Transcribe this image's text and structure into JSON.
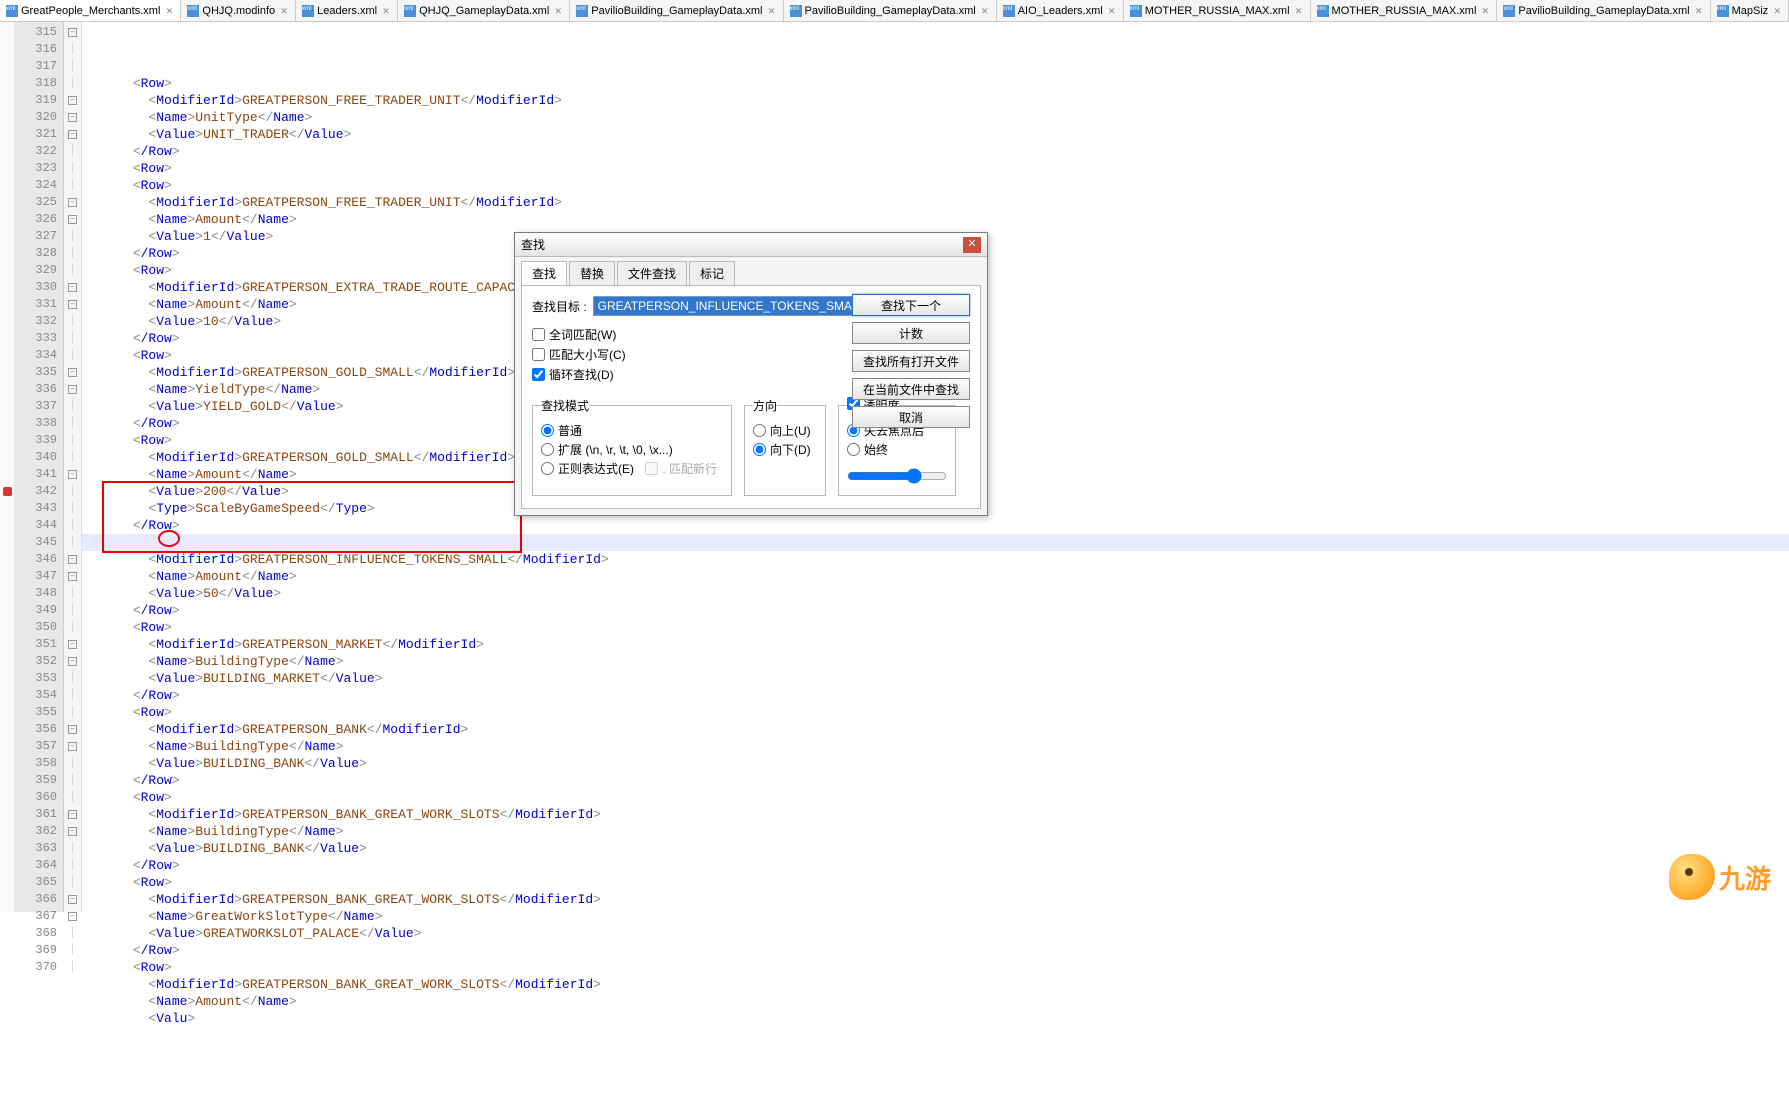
{
  "tabs": [
    {
      "label": "GreatPeople_Merchants.xml",
      "active": true
    },
    {
      "label": "QHJQ.modinfo",
      "active": false
    },
    {
      "label": "Leaders.xml",
      "active": false
    },
    {
      "label": "QHJQ_GameplayData.xml",
      "active": false
    },
    {
      "label": "PavilioBuilding_GameplayData.xml",
      "active": false
    },
    {
      "label": "PavilioBuilding_GameplayData.xml",
      "active": false
    },
    {
      "label": "AIO_Leaders.xml",
      "active": false
    },
    {
      "label": "MOTHER_RUSSIA_MAX.xml",
      "active": false
    },
    {
      "label": "MOTHER_RUSSIA_MAX.xml",
      "active": false
    },
    {
      "label": "PavilioBuilding_GameplayData.xml",
      "active": false
    },
    {
      "label": "MapSiz",
      "active": false
    }
  ],
  "line_start": 315,
  "highlight_line_index": 30,
  "code_lines": [
    {
      "i": 0,
      "t": "      <Row>"
    },
    {
      "i": 1,
      "t": "        <ModifierId>",
      "v": "GREATPERSON_FREE_TRADER_UNIT",
      "c": "</ModifierId>"
    },
    {
      "i": 1,
      "t": "        <Name>",
      "v": "UnitType",
      "c": "</Name>"
    },
    {
      "i": 1,
      "t": "        <Value>",
      "v": "UNIT_TRADER",
      "c": "</Value>"
    },
    {
      "i": 0,
      "t": "      </Row>"
    },
    {
      "i": 0,
      "t": "      <Row>"
    },
    {
      "i": 0,
      "t": "      <Row>"
    },
    {
      "i": 1,
      "t": "        <ModifierId>",
      "v": "GREATPERSON_FREE_TRADER_UNIT",
      "c": "</ModifierId>"
    },
    {
      "i": 1,
      "t": "        <Name>",
      "v": "Amount",
      "c": "</Name>"
    },
    {
      "i": 1,
      "t": "        <Value>",
      "v": "1",
      "c": "</Value>"
    },
    {
      "i": 0,
      "t": "      </Row>"
    },
    {
      "i": 0,
      "t": "      <Row>"
    },
    {
      "i": 1,
      "t": "        <ModifierId>",
      "v": "GREATPERSON_EXTRA_TRADE_ROUTE_CAPACITY",
      "c": "</ModifierId>"
    },
    {
      "i": 1,
      "t": "        <Name>",
      "v": "Amount",
      "c": "</Name>"
    },
    {
      "i": 1,
      "t": "        <Value>",
      "v": "10",
      "c": "</Value>"
    },
    {
      "i": 0,
      "t": "      </Row>"
    },
    {
      "i": 0,
      "t": "      <Row>"
    },
    {
      "i": 1,
      "t": "        <ModifierId>",
      "v": "GREATPERSON_GOLD_SMALL",
      "c": "</ModifierId>"
    },
    {
      "i": 1,
      "t": "        <Name>",
      "v": "YieldType",
      "c": "</Name>"
    },
    {
      "i": 1,
      "t": "        <Value>",
      "v": "YIELD_GOLD",
      "c": "</Value>"
    },
    {
      "i": 0,
      "t": "      </Row>"
    },
    {
      "i": 0,
      "t": "      <Row>"
    },
    {
      "i": 1,
      "t": "        <ModifierId>",
      "v": "GREATPERSON_GOLD_SMALL",
      "c": "</ModifierId>"
    },
    {
      "i": 1,
      "t": "        <Name>",
      "v": "Amount",
      "c": "</Name>"
    },
    {
      "i": 1,
      "t": "        <Value>",
      "v": "200",
      "c": "</Value>"
    },
    {
      "i": 1,
      "t": "        <Type>",
      "v": "ScaleByGameSpeed",
      "c": "</Type>"
    },
    {
      "i": 0,
      "t": "      </Row>"
    },
    {
      "i": 0,
      "t": "      "
    },
    {
      "i": 1,
      "t": "        <ModifierId>",
      "v": "GREATPERSON_INFLUENCE_TOKENS_SMALL",
      "c": "</ModifierId>"
    },
    {
      "i": 1,
      "t": "        <Name>",
      "v": "Amount",
      "c": "</Name>"
    },
    {
      "i": 1,
      "t": "        <Value>",
      "v": "50",
      "c": "</Value>"
    },
    {
      "i": 0,
      "t": "      </Row>"
    },
    {
      "i": 0,
      "t": "      <Row>"
    },
    {
      "i": 1,
      "t": "        <ModifierId>",
      "v": "GREATPERSON_MARKET",
      "c": "</ModifierId>"
    },
    {
      "i": 1,
      "t": "        <Name>",
      "v": "BuildingType",
      "c": "</Name>"
    },
    {
      "i": 1,
      "t": "        <Value>",
      "v": "BUILDING_MARKET",
      "c": "</Value>"
    },
    {
      "i": 0,
      "t": "      </Row>"
    },
    {
      "i": 0,
      "t": "      <Row>"
    },
    {
      "i": 1,
      "t": "        <ModifierId>",
      "v": "GREATPERSON_BANK",
      "c": "</ModifierId>"
    },
    {
      "i": 1,
      "t": "        <Name>",
      "v": "BuildingType",
      "c": "</Name>"
    },
    {
      "i": 1,
      "t": "        <Value>",
      "v": "BUILDING_BANK",
      "c": "</Value>"
    },
    {
      "i": 0,
      "t": "      </Row>"
    },
    {
      "i": 0,
      "t": "      <Row>"
    },
    {
      "i": 1,
      "t": "        <ModifierId>",
      "v": "GREATPERSON_BANK_GREAT_WORK_SLOTS",
      "c": "</ModifierId>"
    },
    {
      "i": 1,
      "t": "        <Name>",
      "v": "BuildingType",
      "c": "</Name>"
    },
    {
      "i": 1,
      "t": "        <Value>",
      "v": "BUILDING_BANK",
      "c": "</Value>"
    },
    {
      "i": 0,
      "t": "      </Row>"
    },
    {
      "i": 0,
      "t": "      <Row>"
    },
    {
      "i": 1,
      "t": "        <ModifierId>",
      "v": "GREATPERSON_BANK_GREAT_WORK_SLOTS",
      "c": "</ModifierId>"
    },
    {
      "i": 1,
      "t": "        <Name>",
      "v": "GreatWorkSlotType",
      "c": "</Name>"
    },
    {
      "i": 1,
      "t": "        <Value>",
      "v": "GREATWORKSLOT_PALACE",
      "c": "</Value>"
    },
    {
      "i": 0,
      "t": "      </Row>"
    },
    {
      "i": 0,
      "t": "      <Row>"
    },
    {
      "i": 1,
      "t": "        <ModifierId>",
      "v": "GREATPERSON_BANK_GREAT_WORK_SLOTS",
      "c": "</ModifierId>"
    },
    {
      "i": 1,
      "t": "        <Name>",
      "v": "Amount",
      "c": "</Name>"
    },
    {
      "i": 1,
      "t": "        <Valu",
      "v": "",
      "c": ""
    }
  ],
  "fold_markers_at": [
    0,
    4,
    5,
    6,
    10,
    11,
    15,
    16,
    20,
    21,
    26,
    31,
    32,
    36,
    37,
    41,
    42,
    46,
    47,
    51,
    52
  ],
  "mark_at": 27,
  "find": {
    "title": "查找",
    "tabs": [
      "查找",
      "替换",
      "文件查找",
      "标记"
    ],
    "active_tab": 0,
    "target_label": "查找目标 :",
    "target_value": "GREATPERSON_INFLUENCE_TOKENS_SMALL",
    "buttons": {
      "find_next": "查找下一个",
      "count": "计数",
      "find_all_open": "查找所有打开文件",
      "find_in_current": "在当前文件中查找",
      "cancel": "取消"
    },
    "checks": {
      "whole_word": "全词匹配(W)",
      "match_case": "匹配大小写(C)",
      "wrap": "循环查找(D)"
    },
    "mode": {
      "legend": "查找模式",
      "normal": "普通",
      "extended": "扩展 (\\n, \\r, \\t, \\0, \\x...)",
      "regex": "正则表达式(E)",
      "regex_nl": ". 匹配新行"
    },
    "dir": {
      "legend": "方向",
      "up": "向上(U)",
      "down": "向下(D)"
    },
    "trans": {
      "legend": "透明度",
      "lose_focus": "失去焦点后",
      "always": "始终"
    },
    "trans_enable": true
  },
  "logo_text": "九游"
}
